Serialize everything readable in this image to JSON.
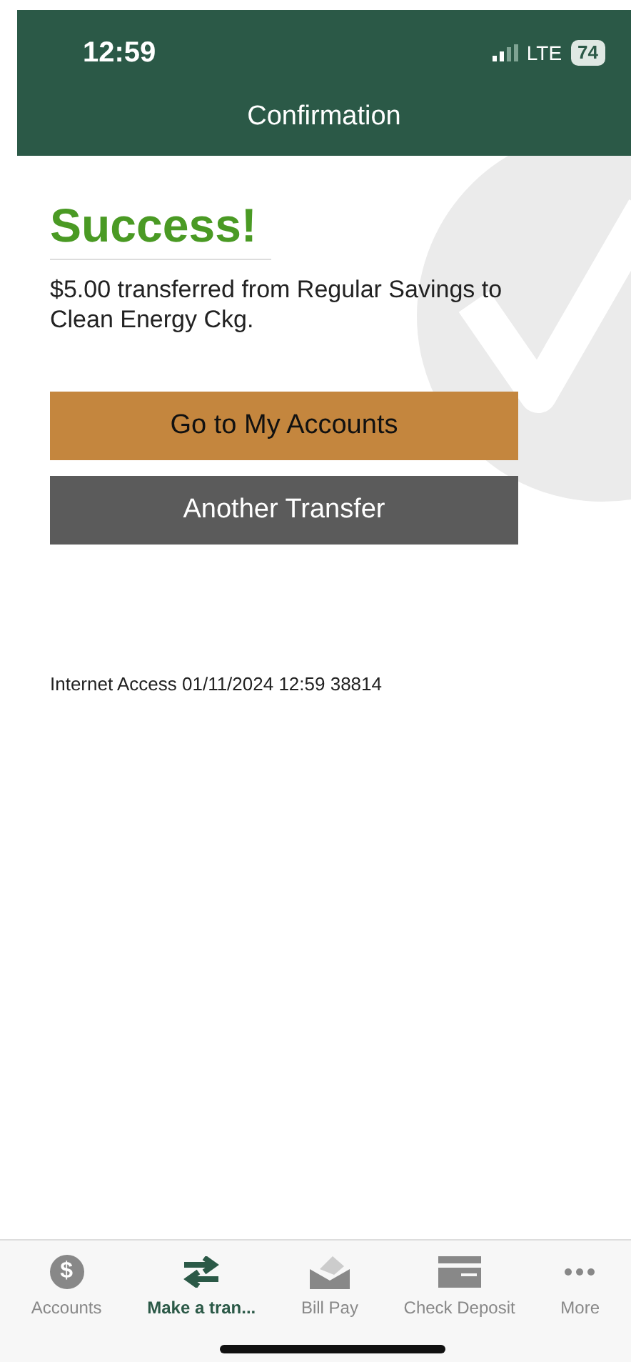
{
  "status_bar": {
    "time": "12:59",
    "network": "LTE",
    "battery": "74"
  },
  "header": {
    "title": "Confirmation"
  },
  "message": {
    "heading": "Success!",
    "text": "$5.00 transferred from Regular Savings to Clean Energy Ckg."
  },
  "buttons": [
    {
      "label": "Go to My Accounts",
      "kind": "primary"
    },
    {
      "label": "Another Transfer",
      "kind": "secondary"
    }
  ],
  "footer_note": "Internet Access 01/11/2024 12:59 38814",
  "tabs": [
    {
      "label": "Accounts",
      "kind": "dollar",
      "glyph": "$",
      "selected": false
    },
    {
      "label": "Make a tran...",
      "kind": "transfer",
      "selected": true
    },
    {
      "label": "Bill Pay",
      "kind": "billpay",
      "selected": false
    },
    {
      "label": "Check Deposit",
      "kind": "deposit",
      "selected": false
    },
    {
      "label": "More",
      "kind": "more",
      "selected": false
    }
  ]
}
